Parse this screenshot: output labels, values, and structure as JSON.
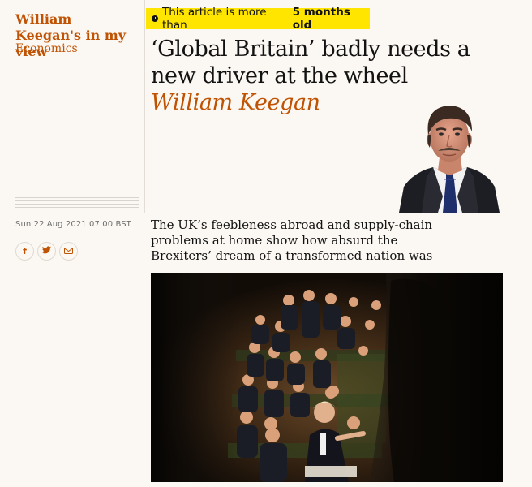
{
  "series": {
    "title": "William Keegan's in my view",
    "section": "Economics"
  },
  "banner": {
    "prefix": "This article is more than",
    "emphasis": "5 months old"
  },
  "article": {
    "headline": "‘Global Britain’ badly needs a new driver at the wheel",
    "author": "William Keegan",
    "dateline": "Sun 22 Aug 2021 07.00 BST",
    "standfirst": "The UK’s feebleness abroad and supply-chain problems at home show how absurd the Brexiters’ dream of a transformed nation was"
  },
  "share": {
    "facebook_glyph": "f",
    "twitter_glyph": "t",
    "email_glyph": "✉"
  },
  "colors": {
    "accent": "#c05303",
    "banner": "#ffe500",
    "background": "#fbf7f2"
  },
  "icons": [
    "clock-icon",
    "facebook-icon",
    "twitter-icon",
    "email-icon"
  ]
}
